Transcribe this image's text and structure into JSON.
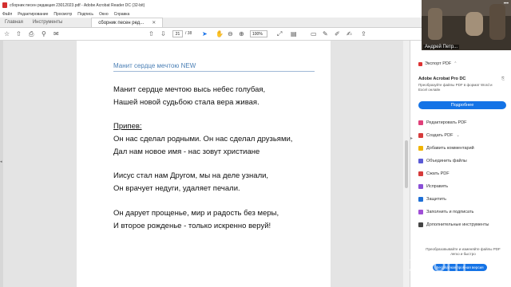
{
  "window": {
    "title": "сборник песен редакция 23012023.pdf - Adobe Acrobat Reader DC (32-bit)"
  },
  "menu": [
    "Файл",
    "Редактирование",
    "Просмотр",
    "Подпись",
    "Окно",
    "Справка"
  ],
  "tabs": {
    "home": "Главная",
    "tools": "Инструменты",
    "document": "сборник песен ред..."
  },
  "toolbar": {
    "page_current": "21",
    "page_total": "/ 38",
    "zoom": "100%"
  },
  "document": {
    "title": "Манит сердце мечтою NEW",
    "verse1": [
      "Манит сердце мечтою высь небес голубая,",
      "Нашей новой судьбою стала вера живая."
    ],
    "chorus_label": "Припев:",
    "chorus": [
      "Он нас сделал родными. Он нас сделал друзьями,",
      "Дал нам новое имя - нас зовут христиане"
    ],
    "verse2": [
      "Иисус стал нам Другом, мы на деле узнали,",
      "Он врачует недуги, удаляет печали."
    ],
    "verse3": [
      "Он дарует прощенье, мир и радость без меры,",
      "И второе рожденье - только искренно веруй!"
    ]
  },
  "video": {
    "name": "Андрей Петр..."
  },
  "right_panel": {
    "export_label": "Экспорт PDF",
    "pro_title": "Adobe Acrobat Pro DC",
    "pro_desc": "Преобразуйте файлы PDF в формат Word и Excel онлайн",
    "pro_button": "Подробнее",
    "tools": [
      {
        "label": "Редактировать PDF",
        "color": "#e0407a",
        "icon": "edit-pdf"
      },
      {
        "label": "Создать PDF",
        "color": "#d63b3b",
        "icon": "create-pdf"
      },
      {
        "label": "Добавить комментарий",
        "color": "#f0b400",
        "icon": "comment"
      },
      {
        "label": "Объединить файлы",
        "color": "#5b5bd6",
        "icon": "combine"
      },
      {
        "label": "Сжать PDF",
        "color": "#d63b3b",
        "icon": "compress"
      },
      {
        "label": "Исправить",
        "color": "#8a4fd6",
        "icon": "redact"
      },
      {
        "label": "Защитить",
        "color": "#1e6fd6",
        "icon": "protect"
      },
      {
        "label": "Заполнить и подписать",
        "color": "#a04fd6",
        "icon": "fill-sign"
      },
      {
        "label": "Дополнительные инструменты",
        "color": "#444444",
        "icon": "more-tools"
      }
    ],
    "footer_text": "Преобразовывайте и изменяйте файлы PDF легко и быстро",
    "footer_button": "Бесплатная пробная версия"
  },
  "watermark": "zoom"
}
